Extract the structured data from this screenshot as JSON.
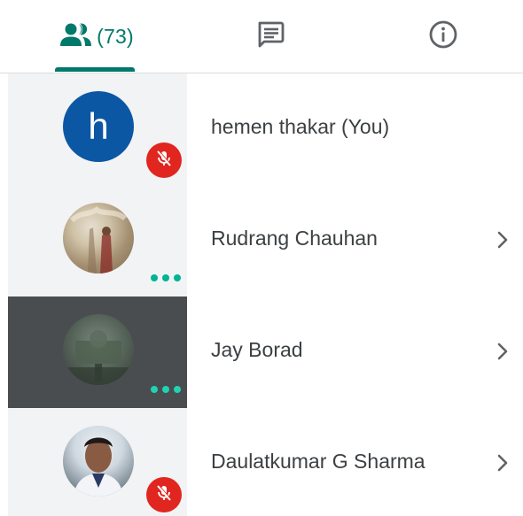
{
  "tabs": {
    "people": {
      "icon": "people-icon",
      "count_label": "(73)"
    },
    "chat": {
      "icon": "chat-icon"
    },
    "info": {
      "icon": "info-icon"
    }
  },
  "colors": {
    "accent": "#00796b",
    "mute_badge": "#e0261f",
    "speaking_dots": "#00b395",
    "letter_avatar": "#0b57a4",
    "tile_bg": "#f1f3f4",
    "active_tile_bg": "#4a4d4f"
  },
  "participants": [
    {
      "name": "hemen thakar (You)",
      "avatar_letter": "h",
      "muted": true,
      "has_chevron": false
    },
    {
      "name": "Rudrang Chauhan",
      "avatar_letter": "",
      "muted": false,
      "has_chevron": true
    },
    {
      "name": "Jay Borad",
      "avatar_letter": "",
      "muted": false,
      "has_chevron": true
    },
    {
      "name": "Daulatkumar G Sharma",
      "avatar_letter": "",
      "muted": true,
      "has_chevron": true
    }
  ]
}
